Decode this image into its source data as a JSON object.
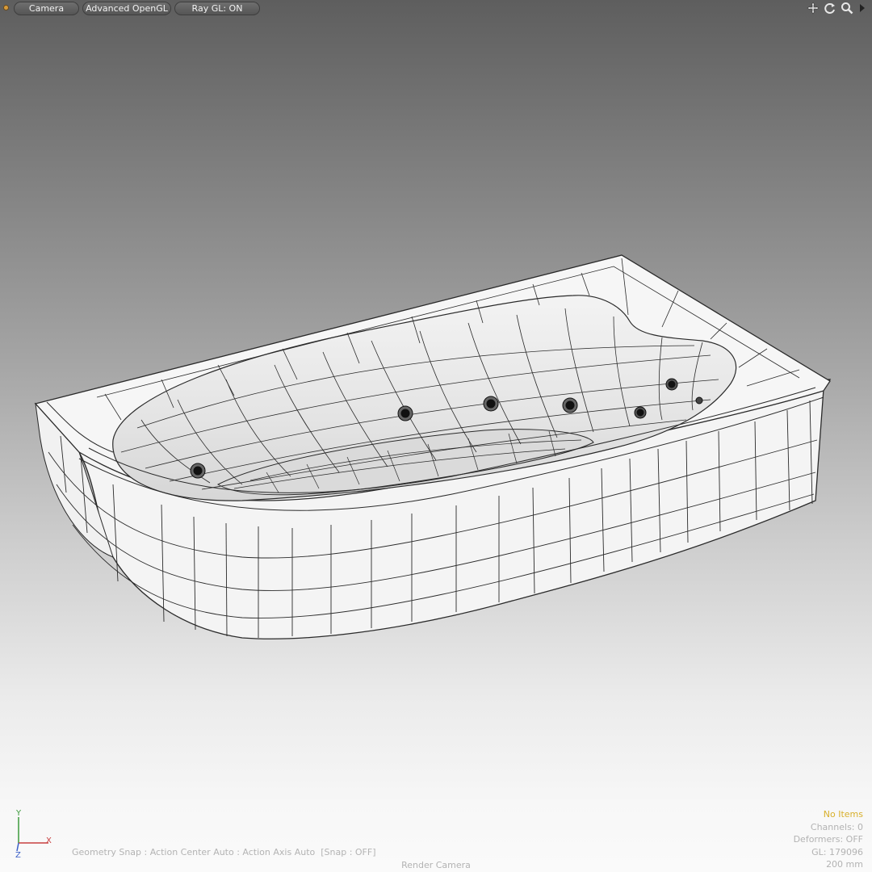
{
  "toolbar": {
    "camera_label": "Camera",
    "opengl_label": "Advanced OpenGL",
    "raygl_label": "Ray GL: ON",
    "icons": [
      "move-view-icon",
      "rotate-view-icon",
      "zoom-view-icon",
      "viewport-menu-icon"
    ]
  },
  "axis": {
    "y": "Y",
    "x": "X",
    "z": "Z"
  },
  "status": {
    "snap": "Geometry Snap : Action Center Auto : Action Axis Auto  [Snap : OFF]",
    "render_camera": "Render Camera"
  },
  "info": {
    "selection": "No Items",
    "channels": "Channels: 0",
    "deformers": "Deformers: OFF",
    "gl": "GL: 179096",
    "grid_size": "200 mm"
  },
  "colors": {
    "background_top": "#5e5e5e",
    "background_bottom": "#fafafa",
    "wire": "#2a2a2a",
    "selection_text": "#d8b02c",
    "status_text": "#b3b3b3",
    "axis_x": "#c84040",
    "axis_y": "#3c9a3c",
    "axis_z": "#3c5fc8"
  }
}
